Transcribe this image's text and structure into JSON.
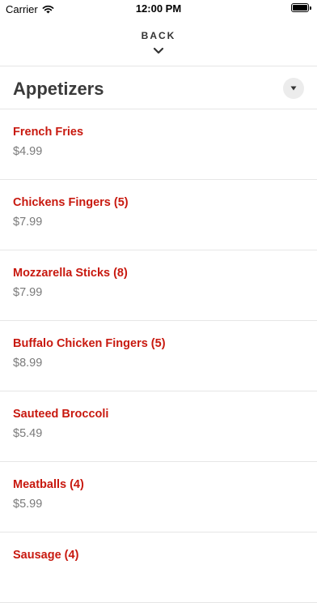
{
  "status_bar": {
    "carrier": "Carrier",
    "time": "12:00 PM"
  },
  "nav": {
    "back_label": "BACK"
  },
  "section": {
    "title": "Appetizers"
  },
  "colors": {
    "item_name": "#c8190f",
    "price": "#7a7a7a",
    "divider": "#e6e6e6"
  },
  "items": [
    {
      "name": "French Fries",
      "price": "$4.99"
    },
    {
      "name": "Chickens Fingers (5)",
      "price": "$7.99"
    },
    {
      "name": "Mozzarella Sticks (8)",
      "price": "$7.99"
    },
    {
      "name": "Buffalo Chicken Fingers (5)",
      "price": "$8.99"
    },
    {
      "name": "Sauteed Broccoli",
      "price": "$5.49"
    },
    {
      "name": "Meatballs (4)",
      "price": "$5.99"
    },
    {
      "name": "Sausage (4)",
      "price": ""
    }
  ]
}
